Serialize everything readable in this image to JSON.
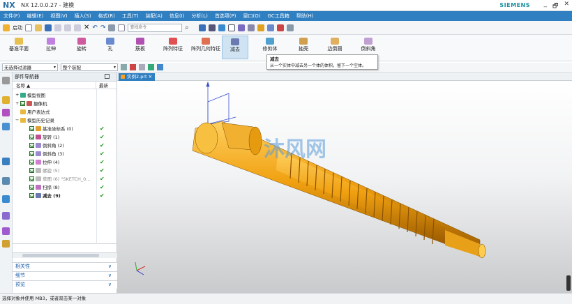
{
  "titlebar": {
    "logo": "NX",
    "title": "NX 12.0.0.27 - 建模",
    "brand": "SIEMENS",
    "min": "_",
    "restore": "🗗",
    "close": "✕"
  },
  "menu": [
    "文件(F)",
    "编辑(E)",
    "视图(V)",
    "插入(S)",
    "格式(R)",
    "工具(T)",
    "装配(A)",
    "信息(I)",
    "分析(L)",
    "首选项(P)",
    "窗口(O)",
    "GC工具箱",
    "帮助(H)"
  ],
  "quickaccess": {
    "start_label": "启动",
    "search_placeholder": "查找命令"
  },
  "ribbon": {
    "buttons": [
      "基准平面",
      "拉伸",
      "旋转",
      "孔",
      "筋板",
      "阵列特征",
      "阵列几何特征",
      "减去",
      "修剪体",
      "抽壳",
      "边倒圆",
      "倒斜角"
    ],
    "selected": "减去"
  },
  "tooltip": {
    "title": "减去",
    "desc": "从一个实体中减去另一个体的体积，留下一个空体。"
  },
  "selection": {
    "filter": "无选择过滤器",
    "scope": "整个装配"
  },
  "navigator": {
    "title": "部件导航器",
    "col_name": "名称",
    "col_latest": "最新",
    "items": [
      {
        "label": "模型视图",
        "kind": "group"
      },
      {
        "label": "摄像机",
        "kind": "group"
      },
      {
        "label": "用户表达式",
        "kind": "group"
      },
      {
        "label": "模型历史记录",
        "kind": "group"
      },
      {
        "label": "基准坐标系 (0)",
        "kind": "feat",
        "ok": "✔"
      },
      {
        "label": "旋转 (1)",
        "kind": "feat",
        "ok": "✔"
      },
      {
        "label": "倒斜角 (2)",
        "kind": "feat",
        "ok": "✔"
      },
      {
        "label": "倒斜角 (3)",
        "kind": "feat",
        "ok": "✔"
      },
      {
        "label": "拉伸 (4)",
        "kind": "feat",
        "ok": "✔"
      },
      {
        "label": "螺旋 (5)",
        "kind": "dim",
        "ok": "✔"
      },
      {
        "label": "草图 (6) \"SKETCH_0...",
        "kind": "dim",
        "ok": "✔"
      },
      {
        "label": "扫掠 (8)",
        "kind": "feat",
        "ok": "✔"
      },
      {
        "label": "减去 (9)",
        "kind": "bold",
        "ok": "✔"
      }
    ],
    "panels": [
      "相关性",
      "细节",
      "预览"
    ]
  },
  "tab": {
    "label": "实例2.prt"
  },
  "watermark": "沐风网",
  "status": "选择对象并使用 MB3，或者双击某一对象"
}
